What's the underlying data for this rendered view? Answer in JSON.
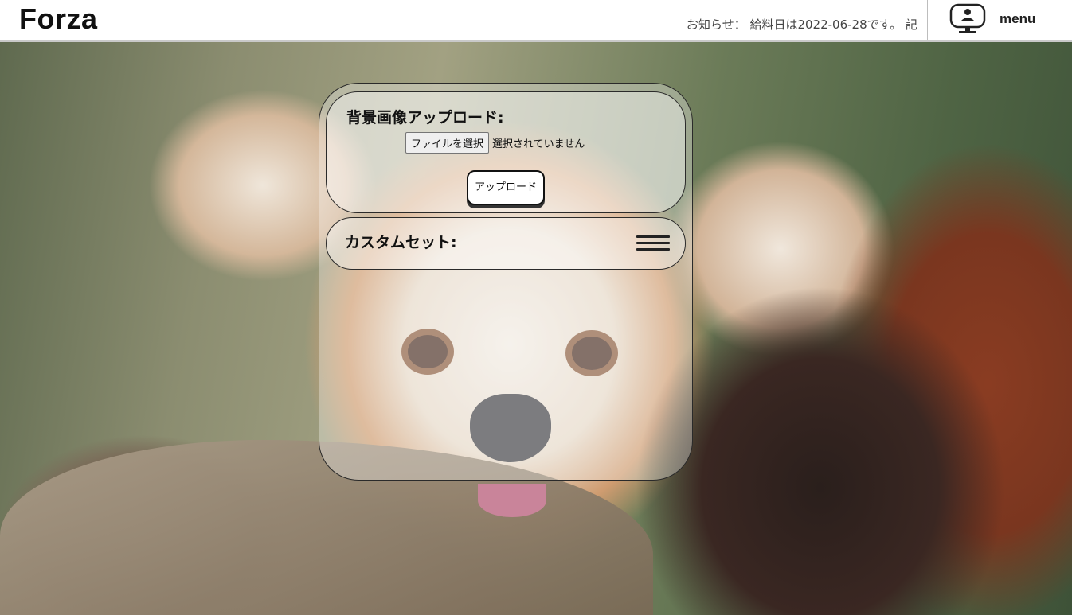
{
  "header": {
    "logo": "Forza",
    "notice": "お知らせ： 給料日は2022-06-28です。 記",
    "menu_label": "menu",
    "menu_icon": "monitor-user-icon"
  },
  "upload_card": {
    "title": "背景画像アップロード:",
    "file_button_label": "ファイルを選択",
    "file_status": "選択されていません",
    "upload_button_label": "アップロード"
  },
  "custom_card": {
    "title": "カスタムセット:",
    "toggle_icon": "hamburger-icon"
  },
  "background": {
    "description_icon": "red-panda-photo"
  },
  "colors": {
    "header_bg": "#ffffff",
    "text_dark": "#111111",
    "panel_border": "#2a2a2a"
  }
}
